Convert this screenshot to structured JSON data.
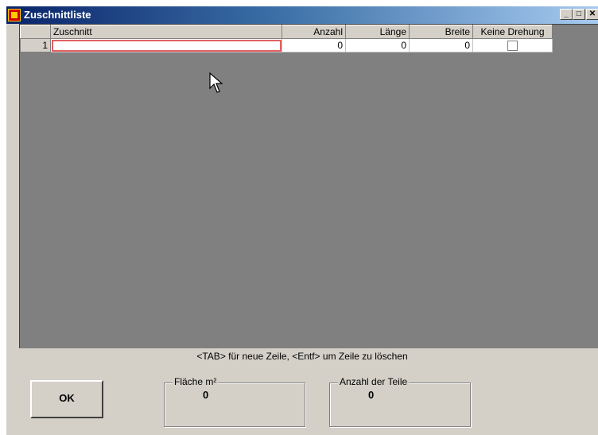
{
  "window": {
    "title": "Zuschnittliste"
  },
  "controls": {
    "min": "_",
    "max": "□",
    "close": "✕"
  },
  "grid": {
    "columns": [
      "Zuschnitt",
      "Anzahl",
      "Länge",
      "Breite",
      "Keine Drehung"
    ],
    "rows": [
      {
        "num": "1",
        "zuschnitt": "",
        "anzahl": "0",
        "laenge": "0",
        "breite": "0",
        "keine_drehung": false
      }
    ]
  },
  "hint": "<TAB> für neue Zeile, <Entf> um Zeile zu löschen",
  "ok_label": "OK",
  "flaeche": {
    "label": "Fläche m²",
    "value": "0"
  },
  "anzahl_teile": {
    "label": "Anzahl der Teile",
    "value": "0"
  }
}
